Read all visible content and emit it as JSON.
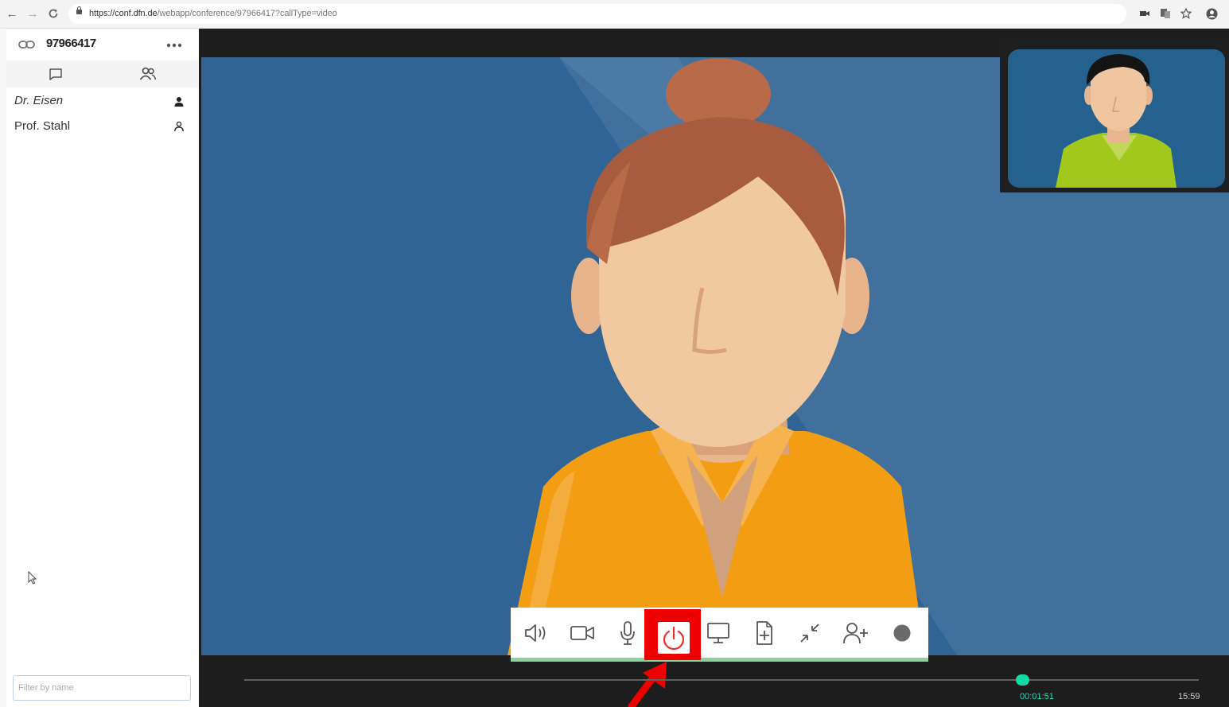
{
  "browser": {
    "url_host": "https://conf.dfn.de",
    "url_path": "/webapp/conference/97966417?callType=video",
    "back_icon": "←",
    "forward_icon": "→",
    "reload_icon": "C"
  },
  "sidebar": {
    "meeting_id": "97966417",
    "participants": [
      {
        "name": "Dr. Eisen"
      },
      {
        "name": "Prof. Stahl"
      }
    ],
    "filter_placeholder": "Filter by name"
  },
  "call": {
    "elapsed": "00:01:51",
    "clock": "15:59",
    "progress": 0.815
  },
  "colors": {
    "hangup_highlight": "#ef0000",
    "progress_thumb": "#10dba6",
    "main_video_bg": "#2f6494"
  }
}
